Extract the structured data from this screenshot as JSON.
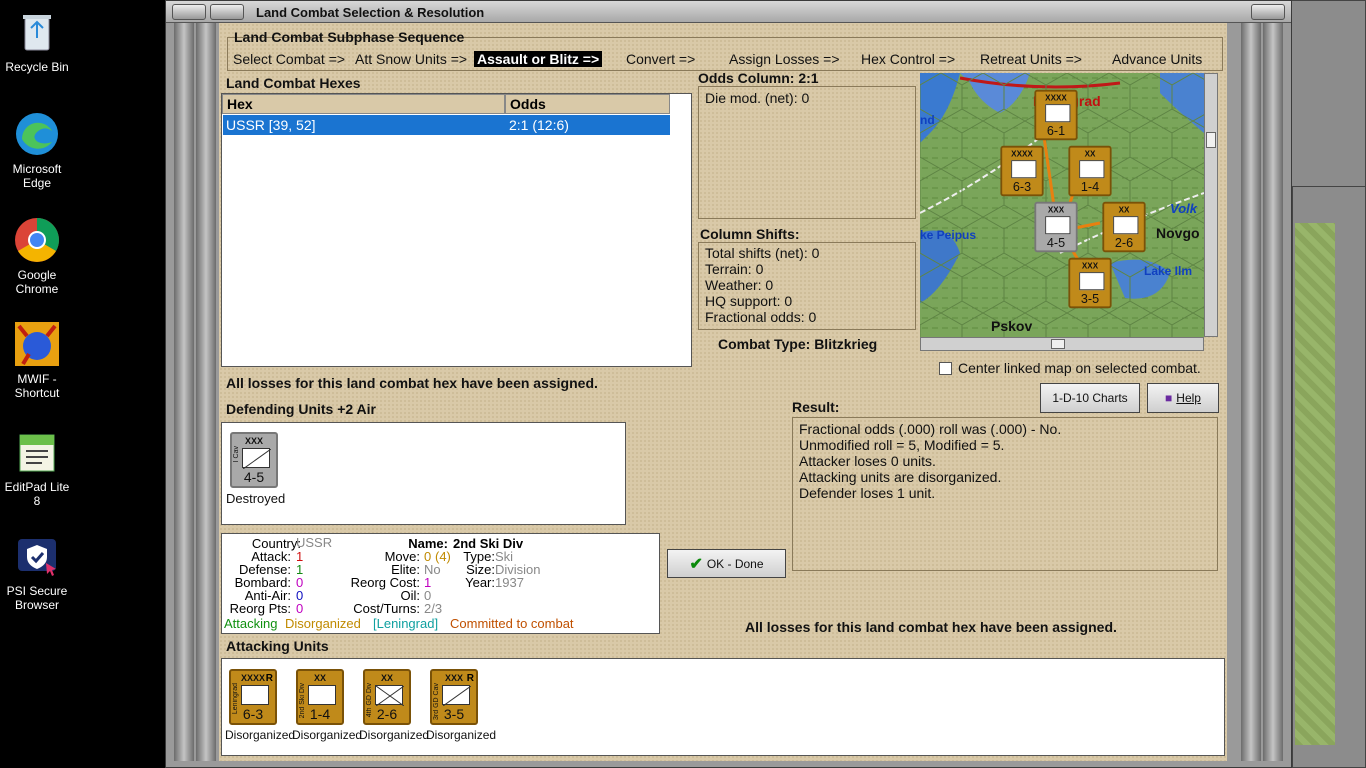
{
  "desktop": {
    "icons": [
      {
        "label": "Recycle Bin"
      },
      {
        "label": "Microsoft Edge"
      },
      {
        "label": "Google Chrome"
      },
      {
        "label": "MWIF - Shortcut"
      },
      {
        "label": "EditPad Lite 8"
      },
      {
        "label": "PSI Secure Browser"
      }
    ]
  },
  "window": {
    "title": "Land Combat Selection & Resolution"
  },
  "subphase": {
    "title": "Land Combat Subphase Sequence",
    "steps": [
      {
        "label": "Select Combat =>"
      },
      {
        "label": "Att Snow Units =>"
      },
      {
        "label": "Assault or Blitz =>"
      },
      {
        "label": "Convert =>"
      },
      {
        "label": "Assign Losses =>"
      },
      {
        "label": "Hex Control =>"
      },
      {
        "label": "Retreat Units =>"
      },
      {
        "label": "Advance Units"
      }
    ],
    "active_index": 2
  },
  "hexes": {
    "title": "Land Combat Hexes",
    "columns": [
      "Hex",
      "Odds"
    ],
    "rows": [
      {
        "hex": "USSR [39, 52]",
        "odds": "2:1 (12:6)"
      }
    ]
  },
  "odds": {
    "title": "Odds Column: 2:1",
    "die_mod": "Die mod. (net): 0"
  },
  "shifts": {
    "title": "Column Shifts:",
    "lines": [
      "Total shifts (net): 0",
      "Terrain: 0",
      "Weather: 0",
      "HQ support: 0",
      "Fractional odds: 0"
    ]
  },
  "combat_type": "Combat Type:  Blitzkrieg",
  "map": {
    "labels": [
      "Leningrad",
      "nd",
      "Volk",
      "ke Peipus",
      "Novgo",
      "Lake Ilm",
      "Pskov"
    ],
    "center_linked": "Center linked map on selected combat."
  },
  "losses_msg": "All losses for this land combat hex have been assigned.",
  "losses_msg2": "All losses for this land combat hex have been assigned.",
  "defending": {
    "title": "Defending Units +2 Air",
    "units": [
      {
        "side": "I Cav",
        "size": "XXX",
        "strength": "4-5",
        "status": "Destroyed"
      }
    ]
  },
  "buttons": {
    "charts": "1-D-10 Charts",
    "help": "Help",
    "ok": "OK - Done"
  },
  "result": {
    "title": "Result:",
    "lines": [
      "Fractional odds (.000) roll was (.000)  - No.",
      "Unmodified roll = 5, Modified = 5.",
      "Attacker loses 0 units.",
      "Attacking units are disorganized.",
      "Defender loses 1 unit."
    ]
  },
  "unit_info": {
    "country_lbl": "Country:",
    "country": "USSR",
    "attack_lbl": "Attack:",
    "attack": "1",
    "defense_lbl": "Defense:",
    "defense": "1",
    "bombard_lbl": "Bombard:",
    "bombard": "0",
    "antiair_lbl": "Anti-Air:",
    "antiair": "0",
    "reorg_lbl": "Reorg Pts:",
    "reorg": "0",
    "name_lbl": "Name:",
    "name": "2nd Ski Div",
    "move_lbl": "Move:",
    "move": "0",
    "move_extra": "(4)",
    "elite_lbl": "Elite:",
    "elite": "No",
    "reorgcost_lbl": "Reorg Cost:",
    "reorgcost": "1",
    "oil_lbl": "Oil:",
    "oil": "0",
    "costturns_lbl": "Cost/Turns:",
    "costturns": "2/3",
    "type_lbl": "Type:",
    "type": "Ski",
    "size_lbl": "Size:",
    "size": "Division",
    "year_lbl": "Year:",
    "year": "1937",
    "status": {
      "attacking": "Attacking",
      "disorganized": "Disorganized",
      "location": "[Leningrad]",
      "committed": "Committed to combat"
    }
  },
  "attacking": {
    "title": "Attacking Units",
    "units": [
      {
        "side": "Leningrad",
        "size": "XXXX",
        "strength": "6-3",
        "status": "Disorganized",
        "r": "R"
      },
      {
        "side": "2nd Ski Div",
        "size": "XX",
        "strength": "1-4",
        "status": "Disorganized",
        "r": ""
      },
      {
        "side": "4th GD Div",
        "size": "XX",
        "strength": "2-6",
        "status": "Disorganized",
        "r": ""
      },
      {
        "side": "3rd GD Cav",
        "size": "XXX",
        "strength": "3-5",
        "status": "Disorganized",
        "r": "R"
      }
    ]
  },
  "map_counters": [
    {
      "side": "8th GD Cav",
      "size": "XXXX",
      "strength": "6-1"
    },
    {
      "side": "Leningrad",
      "size": "XXXX",
      "strength": "6-3"
    },
    {
      "side": "2nd Ski Div",
      "size": "XX",
      "strength": "1-4"
    },
    {
      "side": "I Cav",
      "size": "XXX",
      "strength": "4-5"
    },
    {
      "side": "4th GD Div",
      "size": "XX",
      "strength": "2-6"
    },
    {
      "side": "3rd GD Cav",
      "size": "XXX",
      "strength": "3-5"
    }
  ],
  "colors": {
    "accent_select": "#1a74d1",
    "attack_red": "#d01010",
    "defense_green": "#118811",
    "bombard_magenta": "#c000c0",
    "antiair_blue": "#1010c0",
    "grey_value": "#888888",
    "status_green": "#109010",
    "status_orange": "#c08a00",
    "status_teal": "#10a0a0",
    "status_darkorange": "#c05000"
  }
}
